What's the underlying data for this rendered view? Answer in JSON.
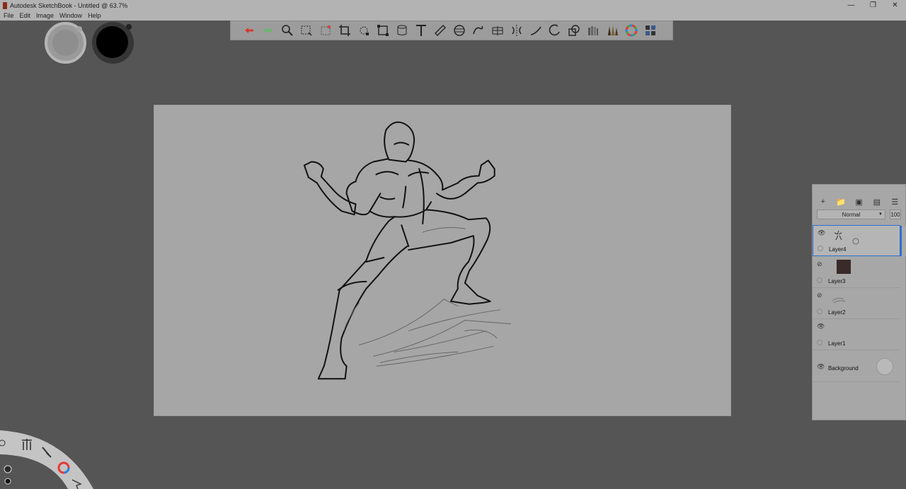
{
  "window": {
    "title": "Autodesk SketchBook - Untitled @ 63.7%"
  },
  "menu": {
    "items": [
      "File",
      "Edit",
      "Image",
      "Window",
      "Help"
    ]
  },
  "toolbar": {
    "tools": [
      "undo-icon",
      "redo-icon",
      "zoom-icon",
      "select-icon",
      "lasso-select-icon",
      "crop-icon",
      "transform-icon",
      "distort-icon",
      "cylinder-icon",
      "text-icon",
      "ruler-icon",
      "ellipse-guide-icon",
      "french-curve-icon",
      "perspective-icon",
      "symmetry-icon",
      "curve-icon",
      "circle-icon",
      "shapes-icon",
      "copic-library-icon",
      "brush-library-icon",
      "color-wheel-icon",
      "brush-sets-icon"
    ]
  },
  "layers": {
    "blend_mode": "Normal",
    "opacity": "100",
    "items": [
      {
        "name": "Layer4",
        "visible": true,
        "active": true
      },
      {
        "name": "Layer3",
        "visible": false
      },
      {
        "name": "Layer2",
        "visible": false
      },
      {
        "name": "Layer1",
        "visible": true
      },
      {
        "name": "Background",
        "visible": true
      }
    ]
  },
  "colors": {
    "accent": "#2d6fd0",
    "undo": "#d23b2f",
    "redo": "#66b86c"
  }
}
